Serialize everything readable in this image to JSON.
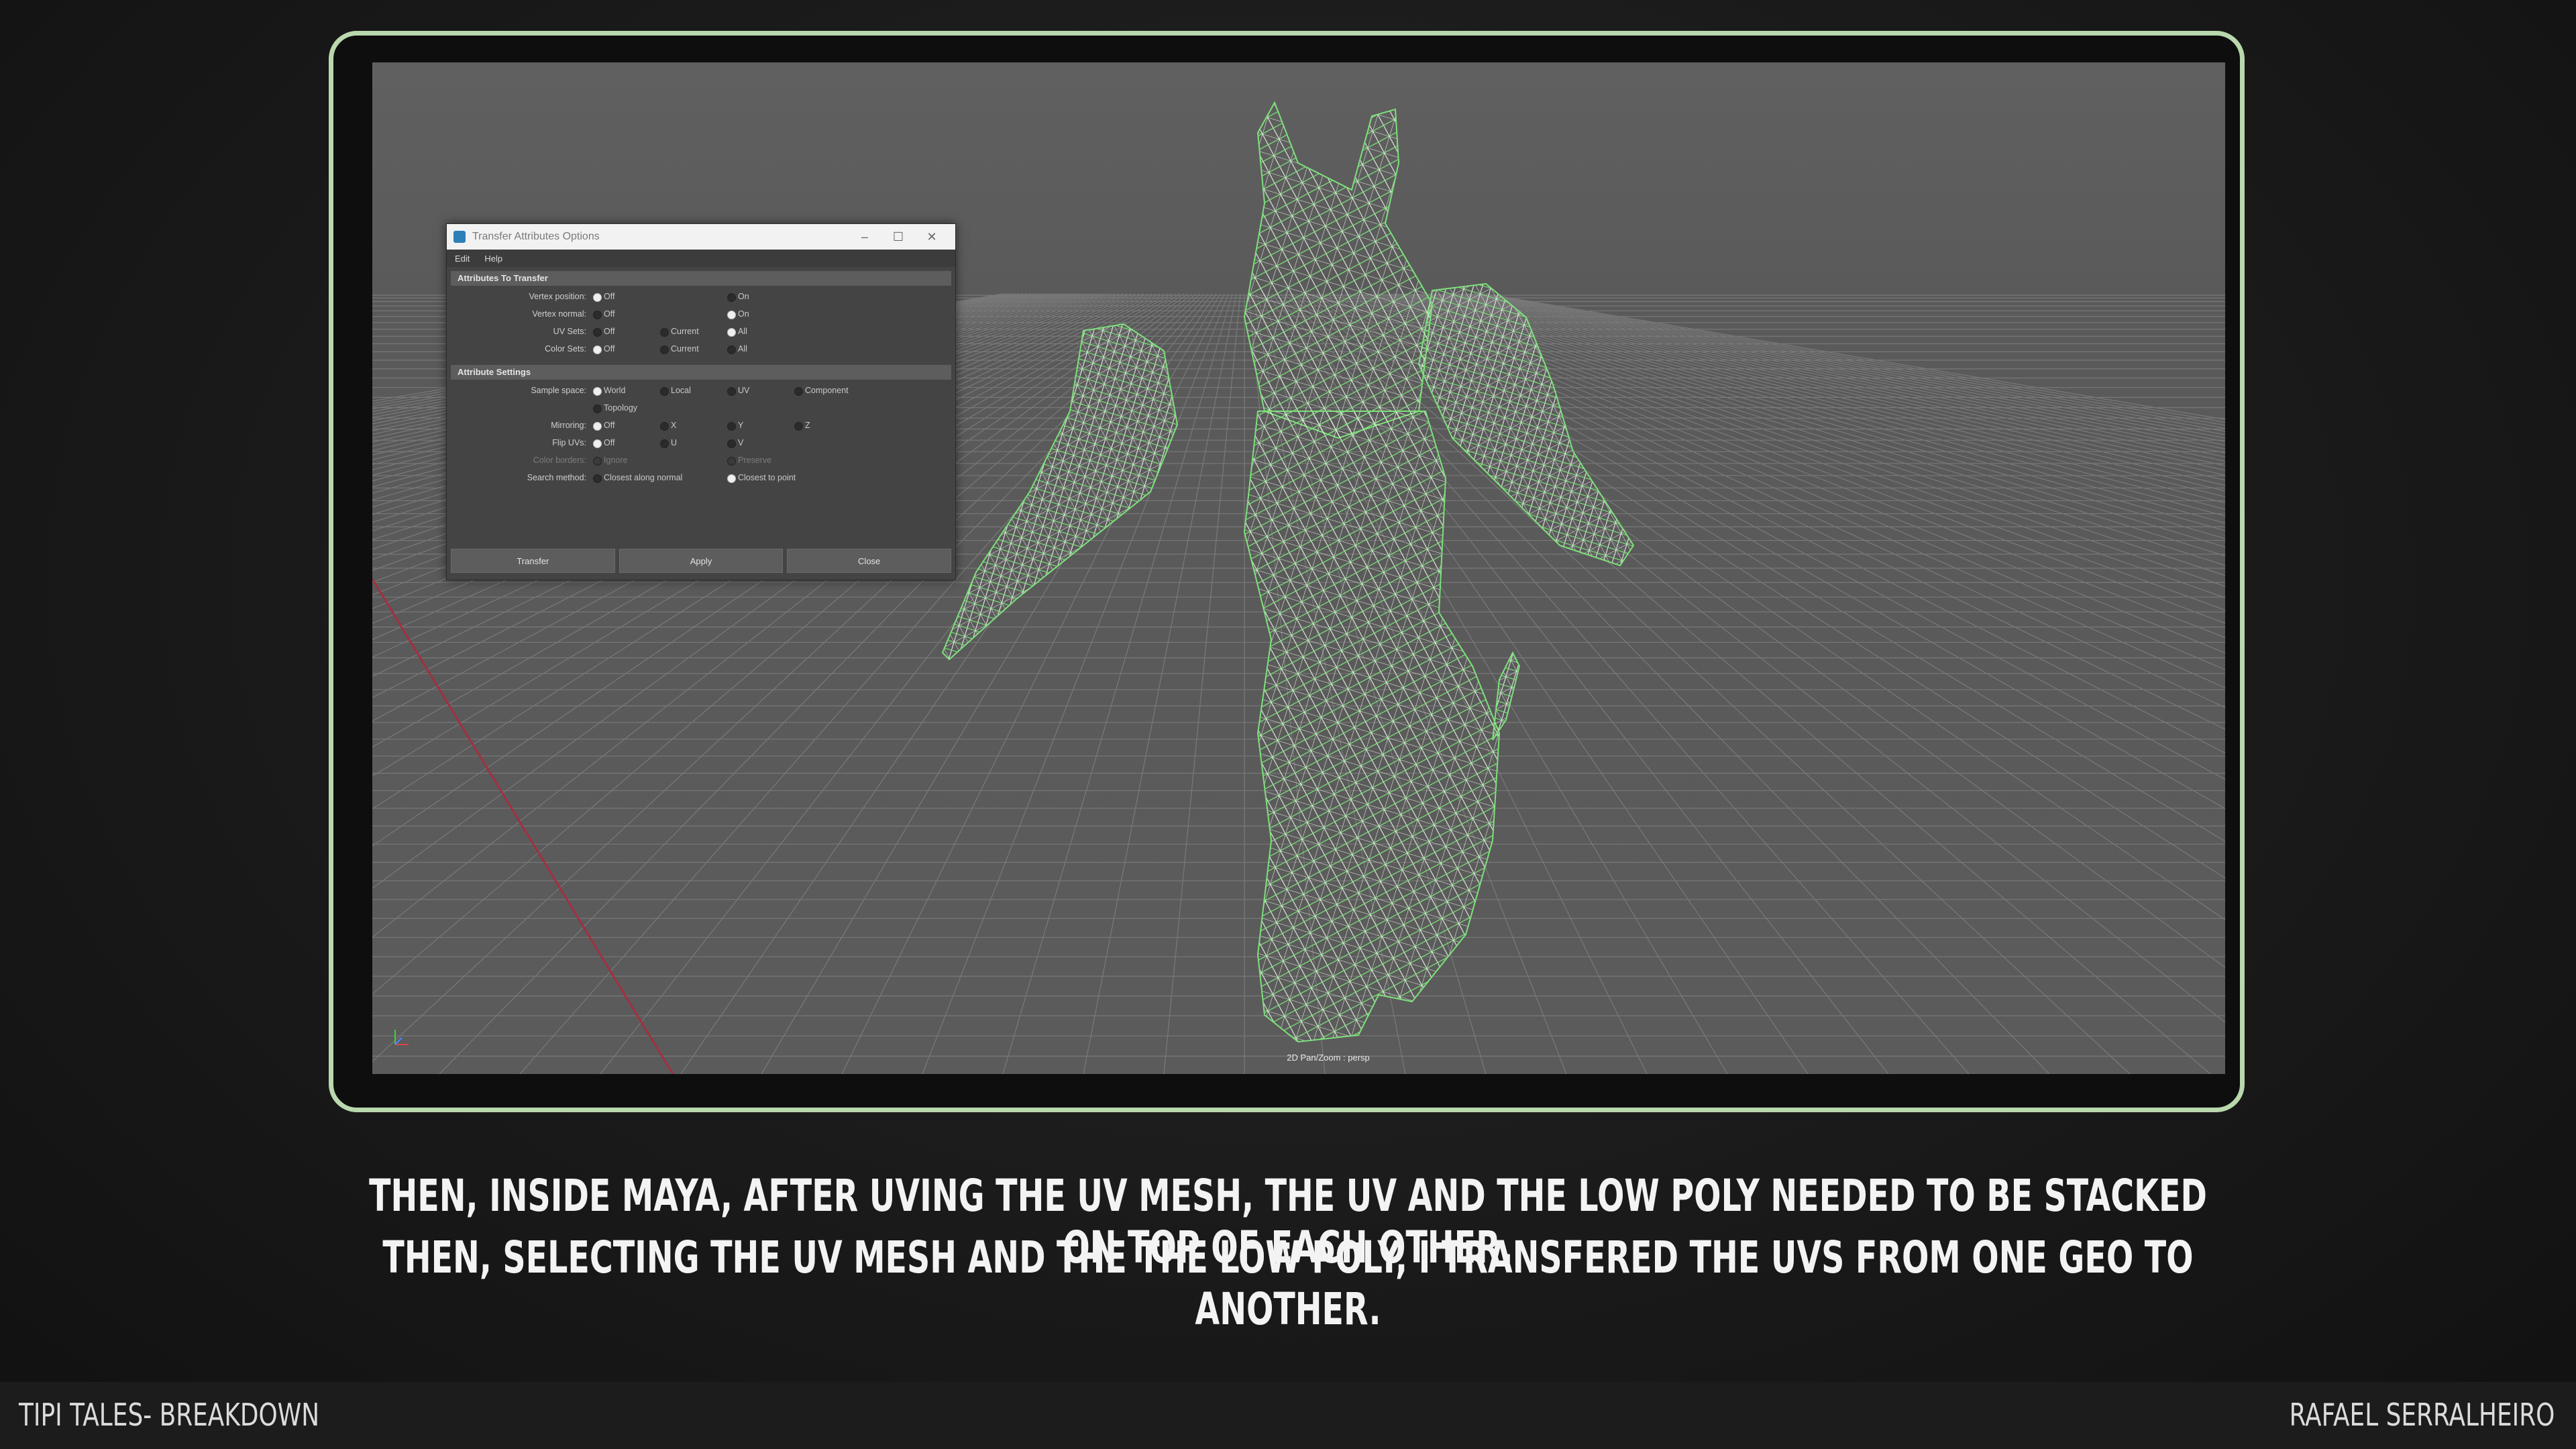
{
  "dialog": {
    "title": "Transfer Attributes Options",
    "menu": [
      "Edit",
      "Help"
    ],
    "window_controls": [
      "–",
      "☐",
      "✕"
    ],
    "section1": "Attributes To Transfer",
    "section2": "Attribute Settings",
    "rows": {
      "vertex_position": {
        "label": "Vertex position:",
        "o1": "Off",
        "o2": "On"
      },
      "vertex_normal": {
        "label": "Vertex normal:",
        "o1": "Off",
        "o2": "On"
      },
      "uv_sets": {
        "label": "UV Sets:",
        "o1": "Off",
        "o2": "Current",
        "o3": "All"
      },
      "color_sets": {
        "label": "Color Sets:",
        "o1": "Off",
        "o2": "Current",
        "o3": "All"
      },
      "sample_space": {
        "label": "Sample space:",
        "o1": "World",
        "o2": "Local",
        "o3": "UV",
        "o4": "Component",
        "o5": "Topology"
      },
      "mirroring": {
        "label": "Mirroring:",
        "o1": "Off",
        "o2": "X",
        "o3": "Y",
        "o4": "Z"
      },
      "flip_uvs": {
        "label": "Flip UVs:",
        "o1": "Off",
        "o2": "U",
        "o3": "V"
      },
      "color_borders": {
        "label": "Color borders:",
        "o1": "Ignore",
        "o2": "Preserve"
      },
      "search_method": {
        "label": "Search method:",
        "o1": "Closest along normal",
        "o2": "Closest to point"
      }
    },
    "buttons": {
      "transfer": "Transfer",
      "apply": "Apply",
      "close": "Close"
    }
  },
  "viewport": {
    "camera_label": "2D Pan/Zoom : persp",
    "wire_color": "#7de07a"
  },
  "caption": {
    "line1": "THEN, INSIDE MAYA, AFTER UVING THE UV MESH, THE UV AND THE LOW POLY NEEDED TO BE STACKED ON TOP OF EACH OTHER.",
    "line2": "THEN, SELECTING THE UV MESH AND THE THE LOW POLY,  I TRANSFERED THE UVS FROM ONE GEO TO ANOTHER."
  },
  "footer": {
    "left": "TIPI TALES- BREAKDOWN",
    "right": "RAFAEL SERRALHEIRO"
  },
  "colors": {
    "frame": "#b9d8ad",
    "background": "#1a1a1a"
  }
}
